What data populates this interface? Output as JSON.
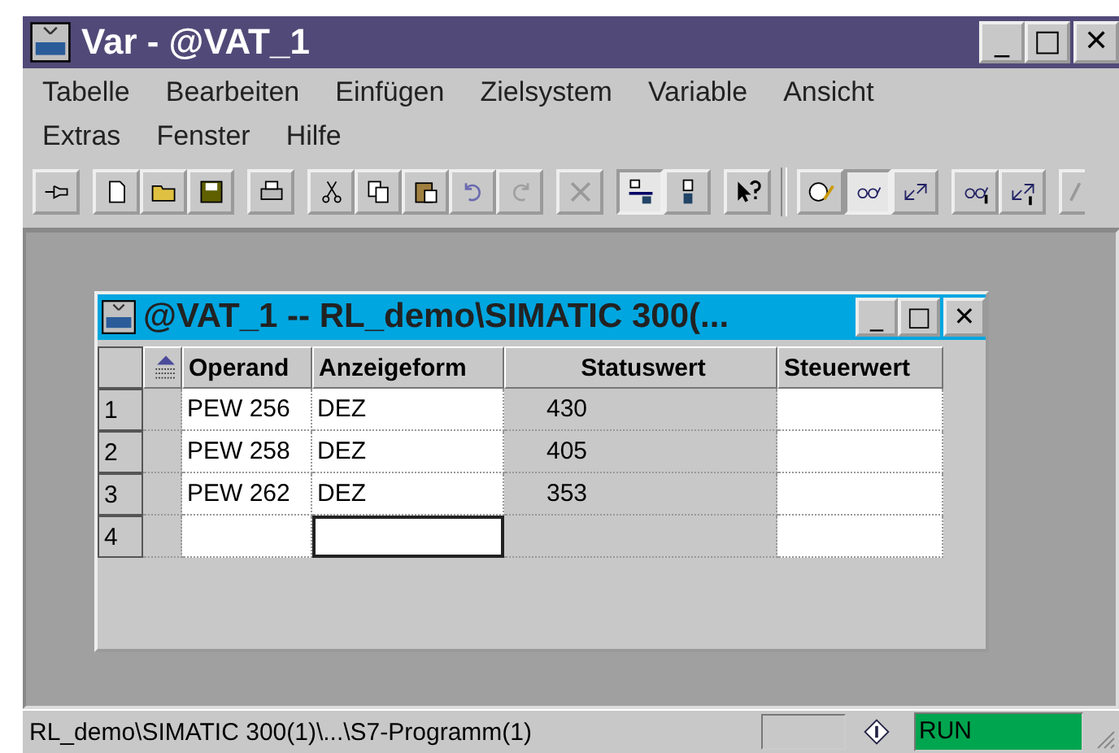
{
  "window": {
    "title": "Var - @VAT_1",
    "controls": [
      "_",
      "□",
      "✕"
    ]
  },
  "menu_rows": [
    [
      {
        "label": "Tabelle"
      },
      {
        "label": "Bearbeiten"
      },
      {
        "label": "Einfügen"
      },
      {
        "label": "Zielsystem"
      },
      {
        "label": "Variable"
      },
      {
        "label": "Ansicht"
      }
    ],
    [
      {
        "label": "Extras"
      },
      {
        "label": "Fenster"
      },
      {
        "label": "Hilfe"
      }
    ]
  ],
  "toolbar": [
    {
      "kind": "pin",
      "pressed": false
    },
    {
      "kind": "gap"
    },
    {
      "kind": "page",
      "pressed": false
    },
    {
      "kind": "folder",
      "pressed": false
    },
    {
      "kind": "disk",
      "pressed": false
    },
    {
      "kind": "gap"
    },
    {
      "kind": "printer",
      "pressed": false
    },
    {
      "kind": "gap"
    },
    {
      "kind": "scissors",
      "pressed": false
    },
    {
      "kind": "copy",
      "pressed": false
    },
    {
      "kind": "clipboard",
      "pressed": false
    },
    {
      "kind": "undo",
      "pressed": false
    },
    {
      "kind": "redo",
      "pressed": false
    },
    {
      "kind": "gap"
    },
    {
      "kind": "cross",
      "pressed": false
    },
    {
      "kind": "gap"
    },
    {
      "kind": "network",
      "pressed": true
    },
    {
      "kind": "device",
      "pressed": false
    },
    {
      "kind": "gap"
    },
    {
      "kind": "help",
      "pressed": false
    },
    {
      "kind": "sep"
    },
    {
      "kind": "clock-pencil",
      "pressed": false
    },
    {
      "kind": "glasses",
      "pressed": true
    },
    {
      "kind": "arrows",
      "pressed": false
    },
    {
      "kind": "gap"
    },
    {
      "kind": "glasses-bar",
      "pressed": false
    },
    {
      "kind": "arrows-bar",
      "pressed": false
    },
    {
      "kind": "gap"
    },
    {
      "kind": "partial",
      "pressed": false
    }
  ],
  "child_window": {
    "title": "@VAT_1 -- RL_demo\\SIMATIC 300(...",
    "controls": [
      "_",
      "□",
      "✕"
    ]
  },
  "table": {
    "columns": [
      {
        "label": "Operand",
        "readonly": false
      },
      {
        "label": "Anzeigeform",
        "readonly": false
      },
      {
        "label": "Statuswert",
        "readonly": true
      },
      {
        "label": "Steuerwert",
        "readonly": false
      }
    ],
    "rows": [
      {
        "number": "1",
        "cells": [
          {
            "text": "PEW 256",
            "focused": false
          },
          {
            "text": "DEZ",
            "focused": false
          },
          {
            "text": "430",
            "focused": false
          },
          {
            "focused": false
          }
        ]
      },
      {
        "number": "2",
        "cells": [
          {
            "text": "PEW 258",
            "focused": false
          },
          {
            "text": "DEZ",
            "focused": false
          },
          {
            "text": "405",
            "focused": false
          },
          {
            "focused": false
          }
        ]
      },
      {
        "number": "3",
        "cells": [
          {
            "text": "PEW 262",
            "focused": false
          },
          {
            "text": "DEZ",
            "focused": false
          },
          {
            "text": "353",
            "focused": false
          },
          {
            "focused": false
          }
        ]
      },
      {
        "number": "4",
        "cells": [
          {
            "focused": false
          },
          {
            "focused": true
          },
          {
            "focused": false
          },
          {
            "focused": false
          }
        ]
      }
    ]
  },
  "status_bar": {
    "path": "RL_demo\\SIMATIC 300(1)\\...\\S7-Programm(1)",
    "mode": "RUN",
    "running": true
  }
}
